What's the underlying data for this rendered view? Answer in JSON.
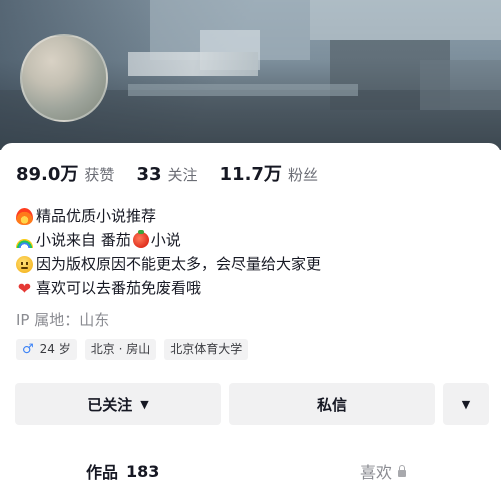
{
  "stats": [
    {
      "value": "89.0万",
      "label": "获赞"
    },
    {
      "value": "33",
      "label": "关注"
    },
    {
      "value": "11.7万",
      "label": "粉丝"
    }
  ],
  "bio": {
    "line1": {
      "icon": "fire-emoji",
      "text": "精品优质小说推荐"
    },
    "line2": {
      "icon": "rainbow-emoji",
      "text_a": "小说来自 番茄",
      "icon_b": "tomato-emoji",
      "text_b": "小说"
    },
    "line3": {
      "icon": "neutral-face-emoji",
      "text": "因为版权原因不能更太多，会尽量给大家更"
    },
    "line4": {
      "icon": "red-heart-emoji",
      "text": "喜欢可以去番茄免废看哦"
    }
  },
  "ip_location": "IP 属地：山东",
  "tags": {
    "age": {
      "icon": "male-icon",
      "text": "24 岁"
    },
    "location": "北京 · 房山",
    "school": "北京体育大学"
  },
  "actions": {
    "follow_label": "已关注",
    "message_label": "私信"
  },
  "tabs": {
    "works_label": "作品",
    "works_count": "183",
    "likes_label": "喜欢"
  }
}
